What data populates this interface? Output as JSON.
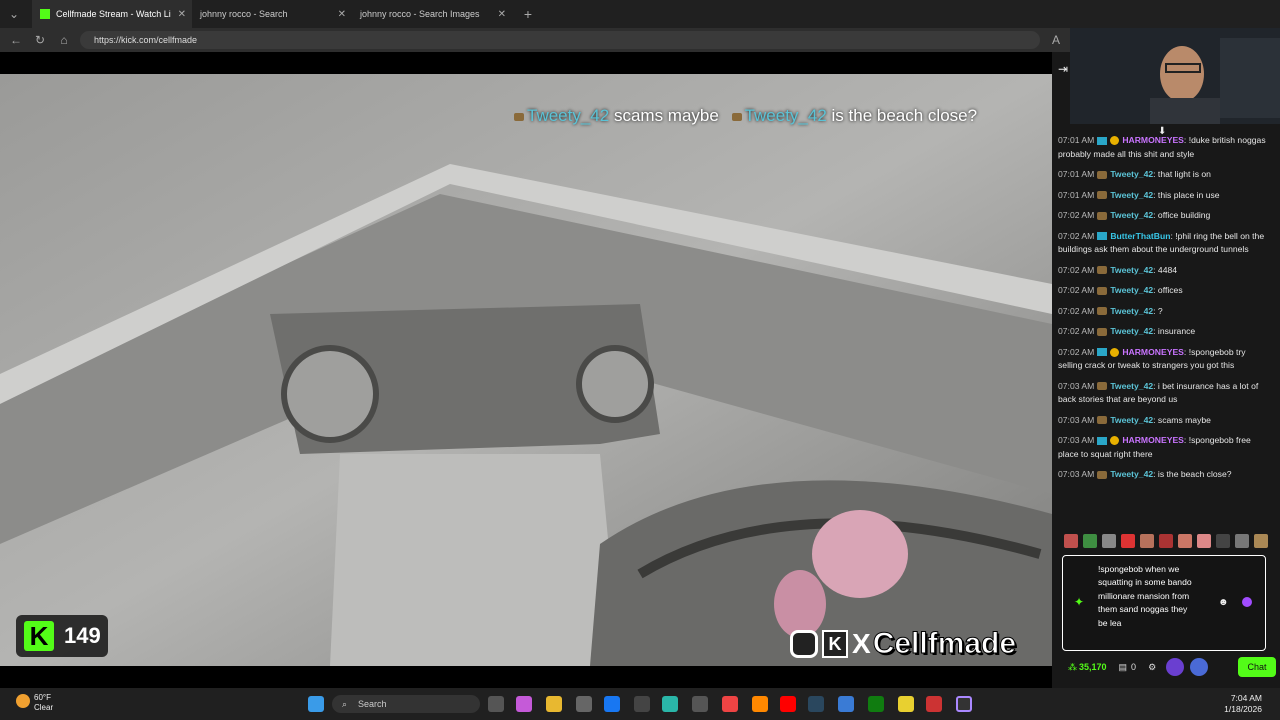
{
  "tabs": [
    {
      "label": "Cellfmade Stream - Watch Li"
    },
    {
      "label": "johnny rocco - Search"
    },
    {
      "label": "johnny rocco - Search Images"
    }
  ],
  "url": "https://kick.com/cellfmade",
  "overlay": {
    "user1": "Tweety_42",
    "msg1": " scams maybe",
    "user2": "Tweety_42",
    "msg2": " is the beach close?"
  },
  "viewer_count": "149",
  "brand": "Cellfmade",
  "chat": [
    {
      "ts": "07:01 AM",
      "user": "HARMONEYES",
      "text": ": !duke british noggas probably made all this shit and style",
      "cls": "u2"
    },
    {
      "ts": "07:01 AM",
      "user": "Tweety_42",
      "text": ": that light is on",
      "cls": "u1"
    },
    {
      "ts": "07:01 AM",
      "user": "Tweety_42",
      "text": ": this place in use",
      "cls": "u1"
    },
    {
      "ts": "07:02 AM",
      "user": "Tweety_42",
      "text": ": office building",
      "cls": "u1"
    },
    {
      "ts": "07:02 AM",
      "user": "ButterThatBun",
      "text": ": !phil ring the bell on the buildings ask them about the underground tunnels",
      "cls": "u3"
    },
    {
      "ts": "07:02 AM",
      "user": "Tweety_42",
      "text": ": 4484",
      "cls": "u1"
    },
    {
      "ts": "07:02 AM",
      "user": "Tweety_42",
      "text": ": offices",
      "cls": "u1"
    },
    {
      "ts": "07:02 AM",
      "user": "Tweety_42",
      "text": ": ?",
      "cls": "u1"
    },
    {
      "ts": "07:02 AM",
      "user": "Tweety_42",
      "text": ": insurance",
      "cls": "u1"
    },
    {
      "ts": "07:02 AM",
      "user": "HARMONEYES",
      "text": ": !spongebob try selling crack or tweak to strangers you got this",
      "cls": "u2"
    },
    {
      "ts": "07:03 AM",
      "user": "Tweety_42",
      "text": ": i bet insurance has a lot of back stories that are beyond us",
      "cls": "u1"
    },
    {
      "ts": "07:03 AM",
      "user": "Tweety_42",
      "text": ": scams maybe",
      "cls": "u1"
    },
    {
      "ts": "07:03 AM",
      "user": "HARMONEYES",
      "text": ": !spongebob free place to squat right there",
      "cls": "u2"
    },
    {
      "ts": "07:03 AM",
      "user": "Tweety_42",
      "text": ": is the beach close?",
      "cls": "u1"
    }
  ],
  "input_text": "!spongebob when we squatting in some bando millionare mansion from them sand noggas they be lea",
  "points": "35,170",
  "zero": "0",
  "chat_button": "Chat",
  "taskbar": {
    "search": "Search",
    "temp": "60°F",
    "weather": "Clear",
    "time": "7:04 AM",
    "date": "1/18/2026"
  }
}
